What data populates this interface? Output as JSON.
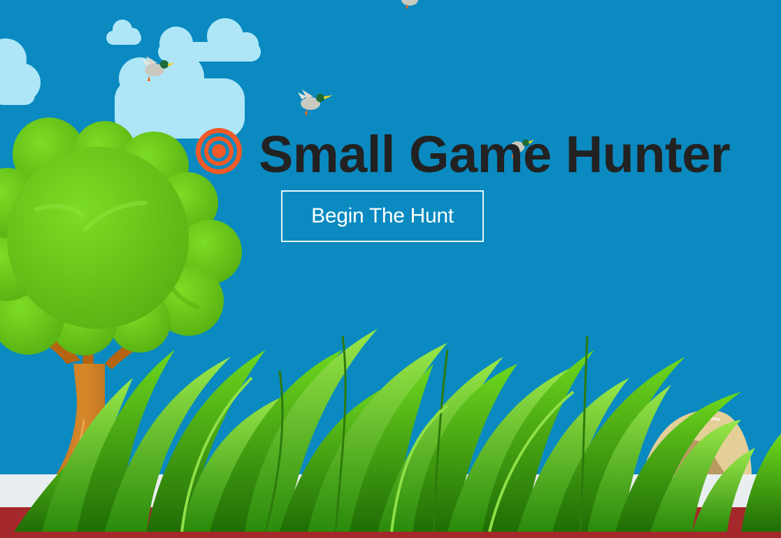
{
  "game": {
    "title": "Small Game Hunter",
    "start_button": "Begin The Hunt"
  },
  "colors": {
    "sky": "#0a8ac0",
    "cloud": "#aee6f8",
    "target": "#f05a28",
    "title": "#222222",
    "tree_leaves": "#6ccc1c",
    "trunk": "#c9781b",
    "ground": "#a5282a",
    "grass": "#3aa010",
    "rock": "#e4cf99"
  },
  "icons": {
    "logo": "target-icon",
    "birds": "duck-icon"
  }
}
